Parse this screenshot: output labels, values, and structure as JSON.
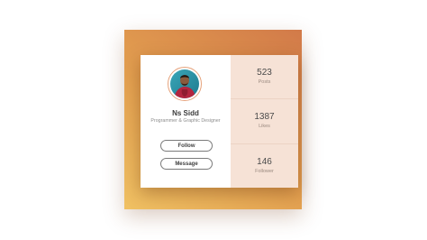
{
  "profile": {
    "name": "Ns Sidd",
    "role": "Programmer & Graphic Designer",
    "follow_label": "Follow",
    "message_label": "Message"
  },
  "stats": [
    {
      "value": "523",
      "label": "Posts"
    },
    {
      "value": "1387",
      "label": "Likes"
    },
    {
      "value": "146",
      "label": "Follower"
    }
  ],
  "colors": {
    "gradient_start": "#f0c163",
    "gradient_end": "#d27a49",
    "stats_panel": "#f6e2d6",
    "avatar_ring": "#e6a37c"
  },
  "icons": {
    "avatar": "profile-photo"
  }
}
